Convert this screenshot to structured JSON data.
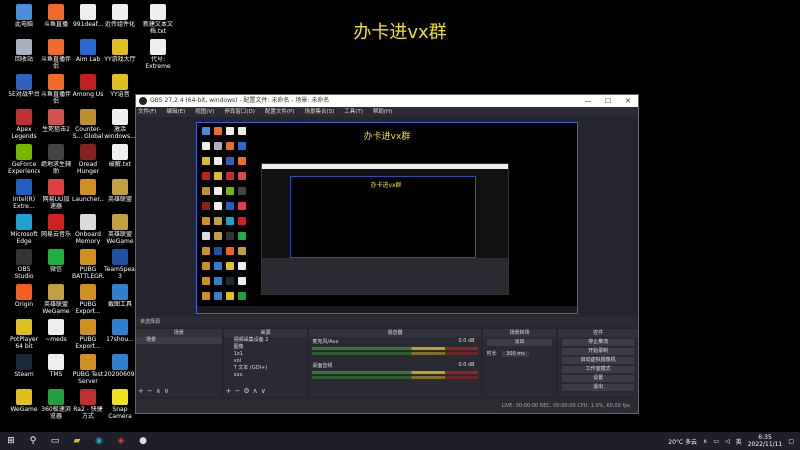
{
  "overlay_text": "办卡进vx群",
  "desktop_icons": [
    {
      "label": "此电脑",
      "color": "#4a90d9"
    },
    {
      "label": "斗鱼直播",
      "color": "#f06a2a"
    },
    {
      "label": "991deaf...",
      "color": "#eeeeee"
    },
    {
      "label": "近传组件化",
      "color": "#eeeeee"
    },
    {
      "label": "新建文本文档.txt",
      "color": "#eeeeee"
    },
    {
      "label": "回收站",
      "color": "#aab0c0"
    },
    {
      "label": "斗鱼直播伴侣",
      "color": "#f06a2a"
    },
    {
      "label": "Aim Lab",
      "color": "#2a6ad0"
    },
    {
      "label": "YY游戏大厅",
      "color": "#e0c020"
    },
    {
      "label": "代号: Extreme",
      "color": "#eeeeee"
    },
    {
      "label": "5E对战平台",
      "color": "#3060c0"
    },
    {
      "label": "斗鱼直播伴侣",
      "color": "#f06a2a"
    },
    {
      "label": "Among Us",
      "color": "#c02020"
    },
    {
      "label": "YY语音",
      "color": "#e0c020"
    },
    {
      "label": "Apex Legends",
      "color": "#c03030"
    },
    {
      "label": "生死狙击2",
      "color": "#d05050"
    },
    {
      "label": "Counter-S... Global Offe...",
      "color": "#c09030"
    },
    {
      "label": "激活 windows...",
      "color": "#eeeeee"
    },
    {
      "label": "GeForce Experience",
      "color": "#76b900"
    },
    {
      "label": "绝地求生辅助",
      "color": "#444444"
    },
    {
      "label": "Dread Hunger",
      "color": "#882222"
    },
    {
      "label": "破解.txt",
      "color": "#eeeeee"
    },
    {
      "label": "Intel(R) Extre...",
      "color": "#2060c0"
    },
    {
      "label": "网易UU加速器",
      "color": "#e04040"
    },
    {
      "label": "Launcher...",
      "color": "#d09020"
    },
    {
      "label": "英雄联盟",
      "color": "#c0a040"
    },
    {
      "label": "Microsoft Edge",
      "color": "#20a0d0"
    },
    {
      "label": "网易云音乐",
      "color": "#d02020"
    },
    {
      "label": "Onboard Memory ...",
      "color": "#dddddd"
    },
    {
      "label": "英雄联盟 WeGame版",
      "color": "#c0a040"
    },
    {
      "label": "OBS Studio",
      "color": "#333333"
    },
    {
      "label": "微信",
      "color": "#20b040"
    },
    {
      "label": "PUBG BATTLEGR...",
      "color": "#d09020"
    },
    {
      "label": "TeamSpeak 3",
      "color": "#2050a0"
    },
    {
      "label": "Origin",
      "color": "#f06020"
    },
    {
      "label": "英雄联盟 WeGame版",
      "color": "#c0a040"
    },
    {
      "label": "PUBG Export...",
      "color": "#d09020"
    },
    {
      "label": "截图工具",
      "color": "#3080d0"
    },
    {
      "label": "PotPlayer 64 bit",
      "color": "#e0c020"
    },
    {
      "label": "~meds",
      "color": "#eeeeee"
    },
    {
      "label": "PUBG Export...",
      "color": "#d09020"
    },
    {
      "label": "17shou...",
      "color": "#3080d0"
    },
    {
      "label": "Steam",
      "color": "#1b2838"
    },
    {
      "label": "TMS",
      "color": "#eeeeee"
    },
    {
      "label": "PUBG Test Server",
      "color": "#d09020"
    },
    {
      "label": "20200609...",
      "color": "#3080d0"
    },
    {
      "label": "WeGame",
      "color": "#e0c020"
    },
    {
      "label": "360极速浏览器",
      "color": "#20a040"
    },
    {
      "label": "Ra2 - 快捷方式",
      "color": "#c03030"
    },
    {
      "label": "Snap Camera",
      "color": "#f0e020"
    }
  ],
  "obs": {
    "title": "OBS 27.2.4 (64-bit, windows) - 配置文件: 未命名 - 场景: 未命名",
    "window_controls": [
      "—",
      "☐",
      "✕"
    ],
    "menu": [
      "文件(F)",
      "编辑(E)",
      "视图(V)",
      "停靠窗口(D)",
      "配置文件(P)",
      "场景集合(S)",
      "工具(T)",
      "帮助(H)"
    ],
    "scene_info": "未选择源",
    "docks": {
      "scenes": {
        "title": "场景",
        "items": [
          "场景"
        ]
      },
      "sources": {
        "title": "来源",
        "items": [
          "视频采集设备 2",
          "图像",
          "1x1",
          "vol",
          "T 文本 (GDI+)",
          "xxx"
        ]
      },
      "mixer": {
        "title": "混音器",
        "tracks": [
          {
            "name": "麦克风/Aux",
            "level": "0.0 dB"
          },
          {
            "name": "桌面音频",
            "level": "0.0 dB"
          }
        ]
      },
      "transitions": {
        "title": "场景转场",
        "type": "淡出",
        "duration_label": "时长",
        "duration": "300 ms"
      },
      "controls": {
        "title": "控件",
        "buttons": [
          "停止推流",
          "开始录制",
          "启动虚拟摄像机",
          "工作室模式",
          "设置",
          "退出"
        ]
      }
    },
    "status": "LIVE: 00:00:00   REC: 00:00:00   CPU: 1.0%, 60.00 fps"
  },
  "taskbar": {
    "weather": "20°C 多云",
    "ime": "英",
    "time": "6:35",
    "date": "2022/11/11"
  }
}
